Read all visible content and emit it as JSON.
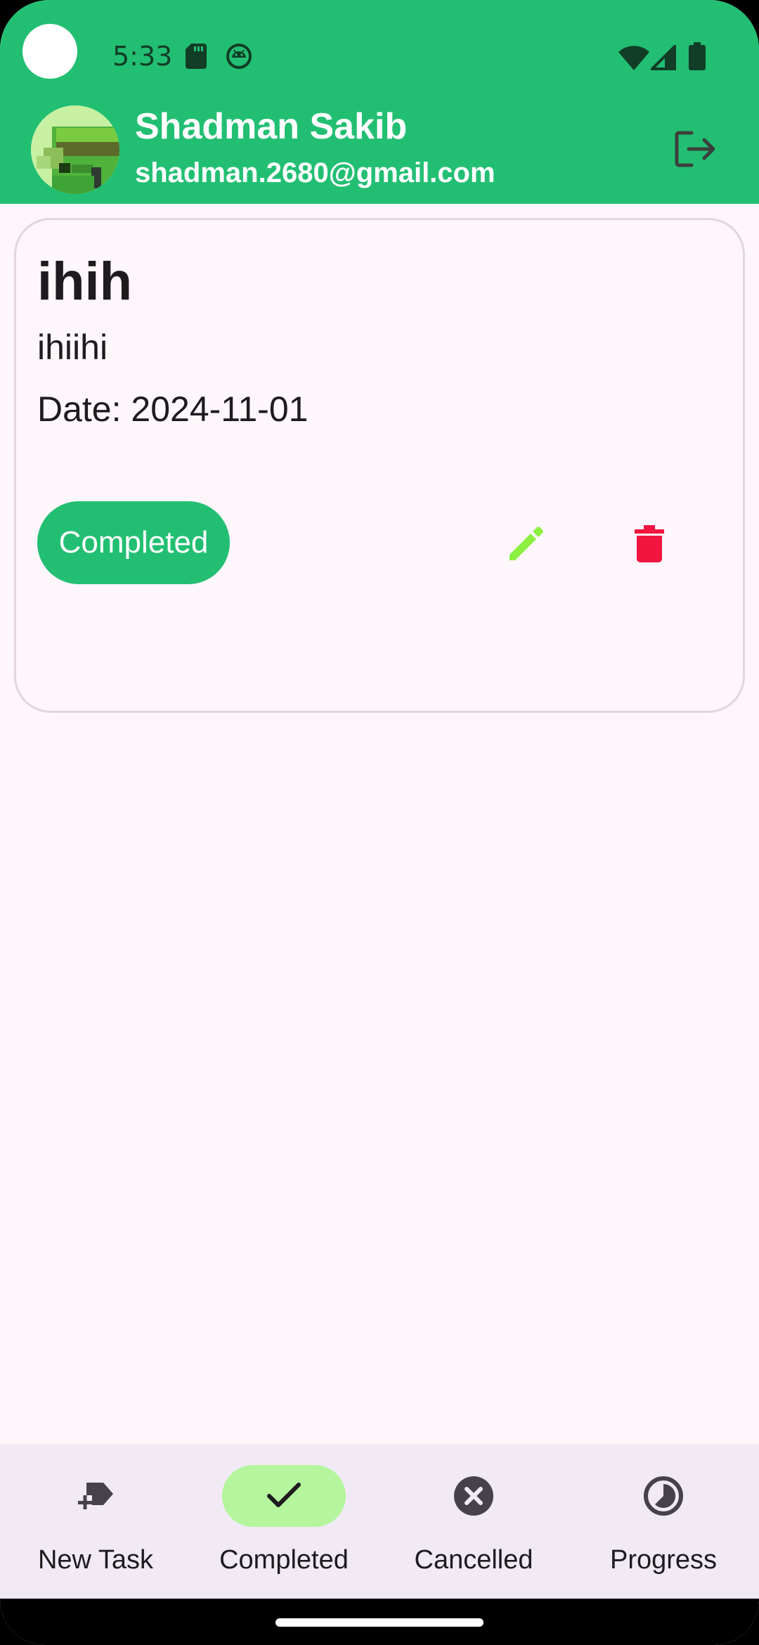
{
  "status_bar": {
    "time": "5:33"
  },
  "app_bar": {
    "user_name": "Shadman Sakib",
    "user_email": "shadman.2680@gmail.com",
    "logout_icon": "logout-icon"
  },
  "task": {
    "title": "ihih",
    "description": "ihiihi",
    "date": "Date: 2024-11-01",
    "status_label": "Completed",
    "status_color": "#22BF73",
    "edit_icon_color": "#8CF042",
    "delete_icon_color": "#F0163F"
  },
  "bottom_nav": {
    "items": [
      {
        "label": "New Task",
        "icon": "add-task-icon",
        "active": false
      },
      {
        "label": "Completed",
        "icon": "check-icon",
        "active": true
      },
      {
        "label": "Cancelled",
        "icon": "cancel-icon",
        "active": false
      },
      {
        "label": "Progress",
        "icon": "progress-icon",
        "active": false
      }
    ]
  },
  "colors": {
    "primary": "#22BF73",
    "background": "#FDF6FB",
    "nav_background": "#F1EAF5",
    "active_pill": "#B5F59D"
  }
}
